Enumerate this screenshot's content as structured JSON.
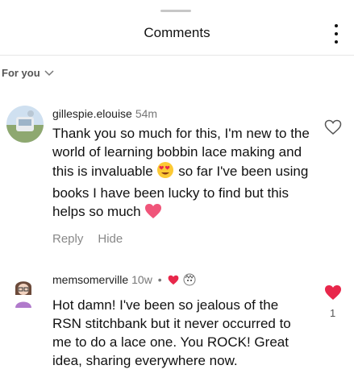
{
  "header": {
    "title": "Comments"
  },
  "filter": {
    "label": "For you"
  },
  "comments": [
    {
      "username": "gillespie.elouise",
      "time": "54m",
      "text_1": "Thank you so much for this, I'm new to the world of learning bobbin lace making and this is invaluable",
      "text_2": " so far I've been using books I have been lucky to find but this helps so much",
      "reply_label": "Reply",
      "hide_label": "Hide",
      "liked": false
    },
    {
      "username": "memsomerville",
      "time": "10w",
      "separator": "•",
      "text": "Hot damn! I've been so jealous of the RSN stitchbank but it never occurred to me to do a lace one. You ROCK! Great idea, sharing everywhere now.",
      "liked": true,
      "like_count": "1"
    }
  ],
  "colors": {
    "heart_red": "#e8274b",
    "muted": "#888888"
  }
}
